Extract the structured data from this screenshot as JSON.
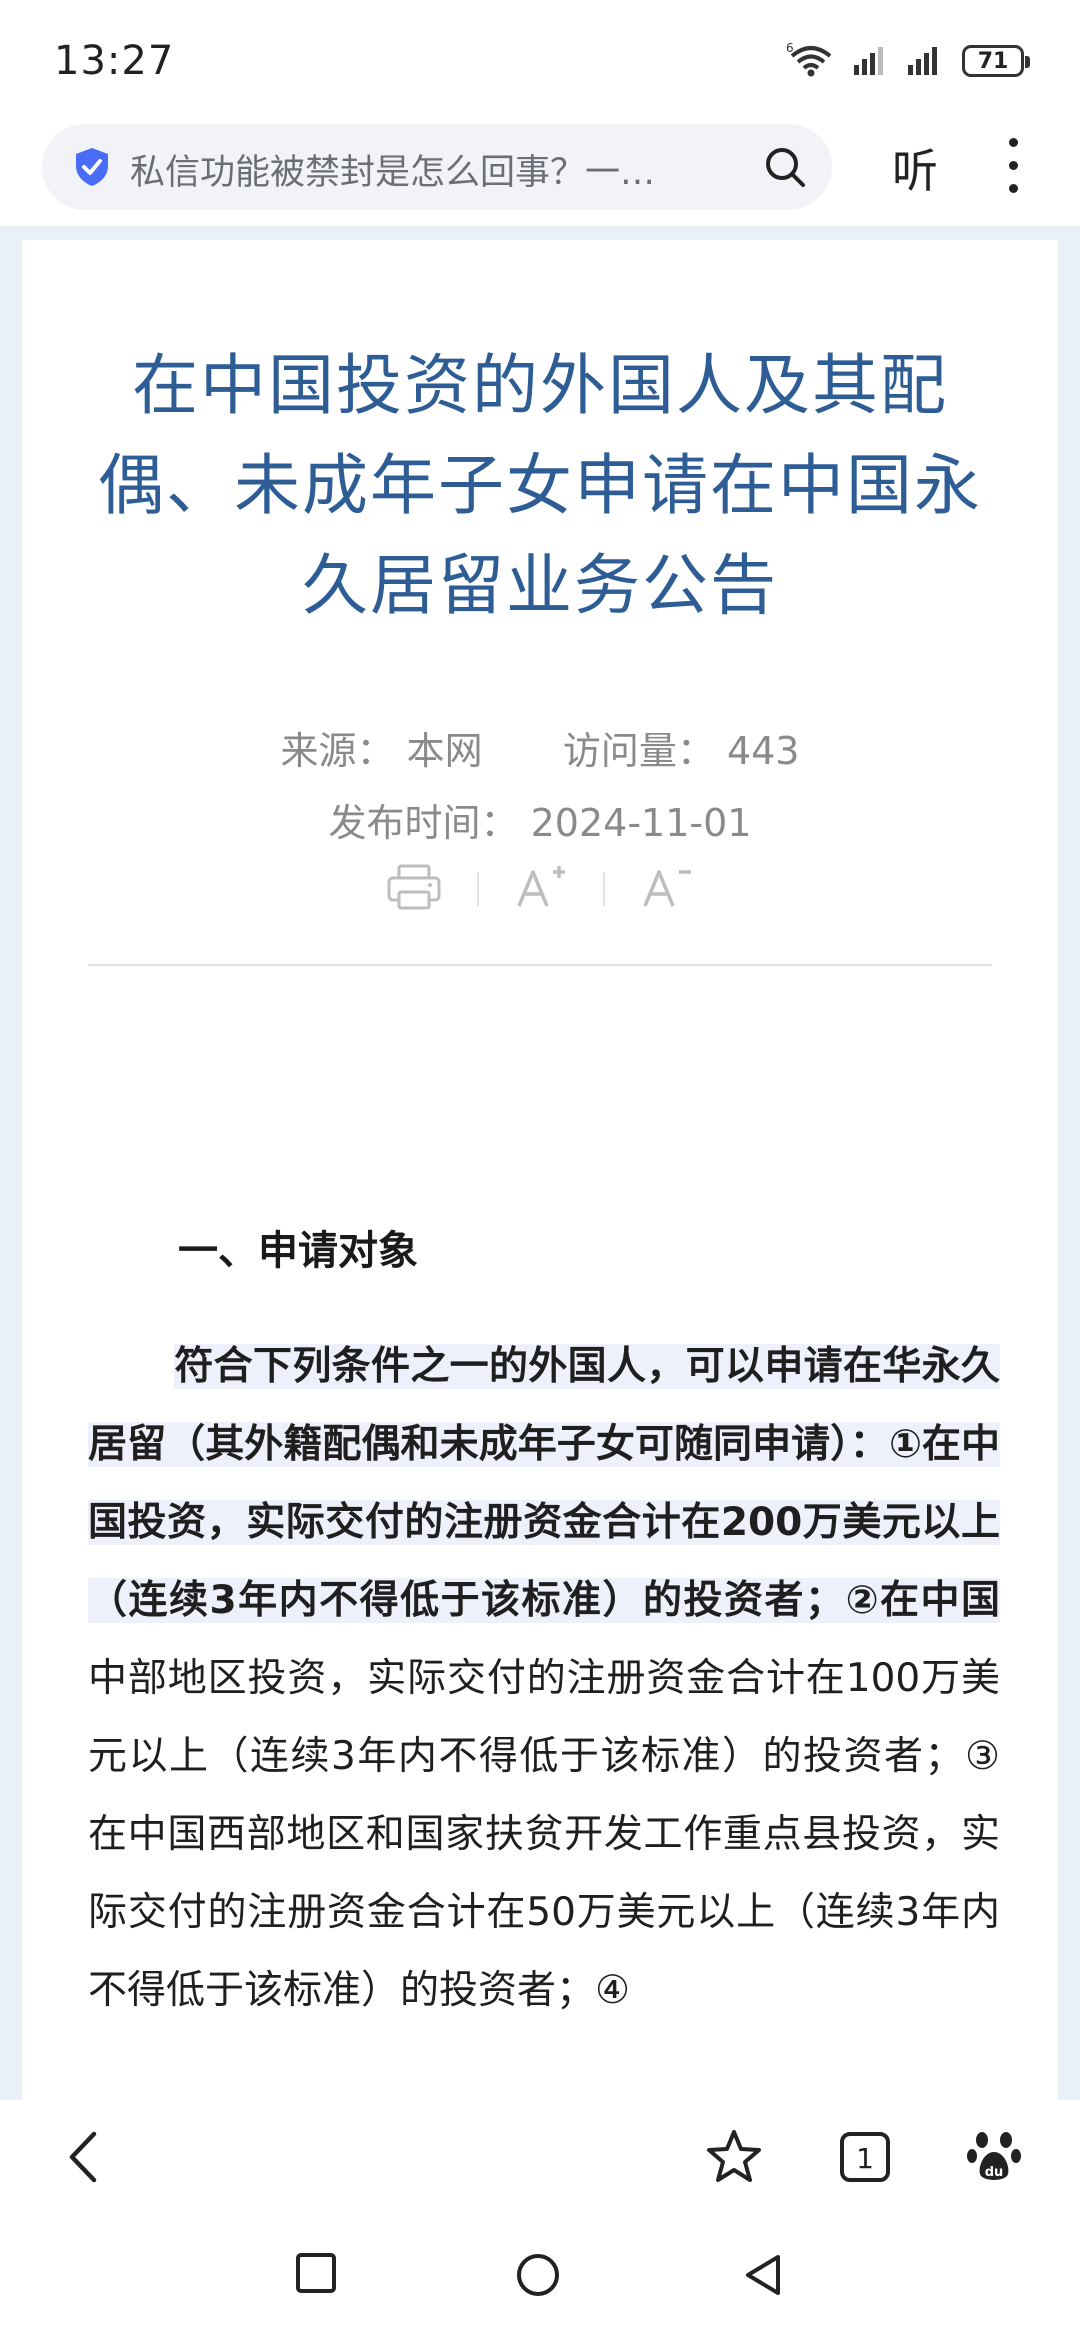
{
  "status_bar": {
    "time": "13:27",
    "wifi_label": "6",
    "battery": "71"
  },
  "address_bar": {
    "text": "私信功能被禁封是怎么回事？一…"
  },
  "toolbar": {
    "listen_label": "听"
  },
  "article": {
    "title": "在中国投资的外国人及其配偶、未成年子女申请在中国永久居留业务公告",
    "source_label": "来源：",
    "source_value": "本网",
    "visits_label": "访问量：",
    "visits_value": "443",
    "publish_label": "发布时间：",
    "publish_value": "2024-11-01",
    "section_heading": "一、申请对象",
    "para_bold": "符合下列条件之一的外国人，可以申请在华永久居留（其外籍配偶和未成年子女可随同申请）：①在中国投资，实际交付的注册资金合计在200万美元以上（连续3年内不得低于该标准）的投资者；②在中国",
    "para_rest": "中部地区投资，实际交付的注册资金合计在100万美元以上（连续3年内不得低于该标准）的投资者；③在中国西部地区和国家扶贫开发工作重点县投资，实际交付的注册资金合计在50万美元以上（连续3年内不得低于该标准）的投资者；④"
  },
  "bottom_bar": {
    "tab_count": "1"
  },
  "colors": {
    "title": "#2e5d95",
    "gutter": "#eaf0f8",
    "highlight": "#eef1fb",
    "shield": "#4a6cf7"
  }
}
